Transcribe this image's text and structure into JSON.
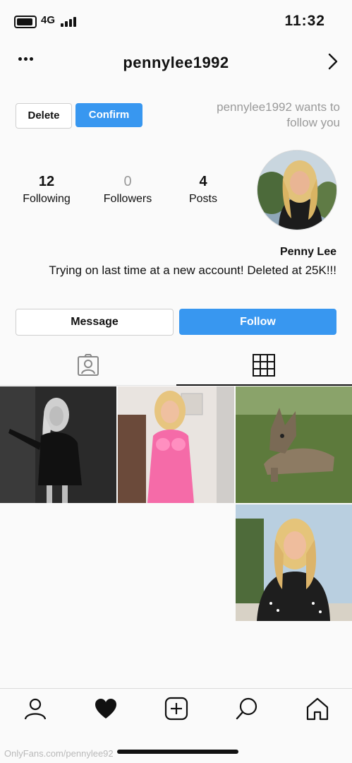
{
  "status_bar": {
    "time": "11:32",
    "network": "4G"
  },
  "header": {
    "username": "pennylee1992"
  },
  "follow_request": {
    "text": "pennylee1992 wants to follow you",
    "confirm_label": "Confirm",
    "delete_label": "Delete"
  },
  "profile": {
    "display_name": "Penny Lee",
    "bio": "Trying on last time at a new account! Deleted at 25K!!!",
    "stats": [
      {
        "value": "4",
        "label": "Posts"
      },
      {
        "value": "0",
        "label": "Followers"
      },
      {
        "value": "12",
        "label": "Following"
      }
    ]
  },
  "actions": {
    "follow_label": "Follow",
    "message_label": "Message"
  },
  "tabs": {
    "active": "grid",
    "items": [
      "grid-icon",
      "tagged-icon"
    ]
  },
  "posts": [
    {
      "name": "post-black-dress-bw"
    },
    {
      "name": "post-pink-dress"
    },
    {
      "name": "post-dog-on-grass"
    },
    {
      "name": "post-polka-dot-outdoor"
    }
  ],
  "bottom_nav": [
    "profile-icon",
    "heart-icon",
    "add-post-icon",
    "search-icon",
    "home-icon"
  ],
  "watermark": "OnlyFans.com/pennylee92",
  "colors": {
    "accent": "#3897f0",
    "background": "#fafafa",
    "muted_text": "#9a9a9a"
  }
}
